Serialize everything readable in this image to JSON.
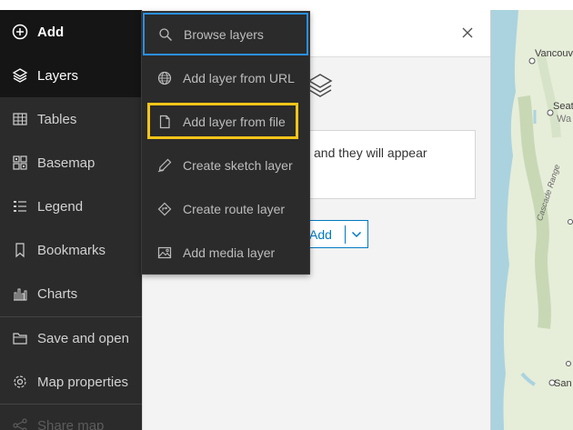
{
  "sidebar": {
    "items": [
      {
        "label": "Add",
        "icon": "plus-circle-icon"
      },
      {
        "label": "Layers",
        "icon": "layers-icon"
      },
      {
        "label": "Tables",
        "icon": "table-icon"
      },
      {
        "label": "Basemap",
        "icon": "basemap-icon"
      },
      {
        "label": "Legend",
        "icon": "legend-icon"
      },
      {
        "label": "Bookmarks",
        "icon": "bookmark-icon"
      },
      {
        "label": "Charts",
        "icon": "chart-icon"
      },
      {
        "label": "Save and open",
        "icon": "folder-icon"
      },
      {
        "label": "Map properties",
        "icon": "gear-icon"
      },
      {
        "label": "Share map",
        "icon": "share-icon"
      }
    ]
  },
  "add_menu": {
    "items": [
      {
        "label": "Browse layers",
        "icon": "search-icon"
      },
      {
        "label": "Add layer from URL",
        "icon": "globe-icon"
      },
      {
        "label": "Add layer from file",
        "icon": "file-icon"
      },
      {
        "label": "Create sketch layer",
        "icon": "pencil-icon"
      },
      {
        "label": "Create route layer",
        "icon": "route-icon"
      },
      {
        "label": "Add media layer",
        "icon": "image-icon"
      }
    ],
    "highlight_color": "#f5c518",
    "focus_color": "#2a8fe6"
  },
  "panel": {
    "hint_fragment": "and they will appear",
    "add_button_label": "Add"
  },
  "map": {
    "labels": {
      "vancouver": "Vancouv",
      "seattle": "Seatt",
      "washington": "Wa",
      "cascade": "Cascade Range",
      "sanfrancisco": "San F"
    }
  },
  "colors": {
    "sidebar_bg": "#2b2b2b",
    "active_bg": "#151515",
    "accent": "#007ac2"
  }
}
